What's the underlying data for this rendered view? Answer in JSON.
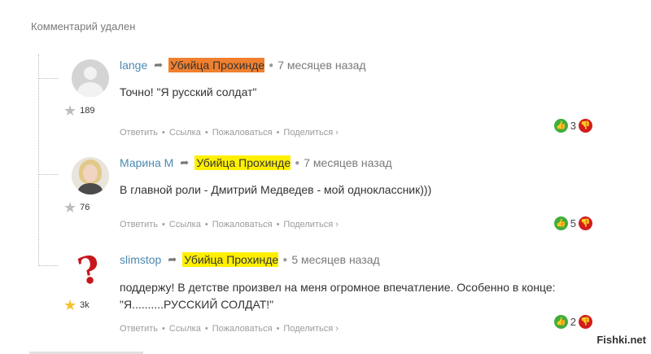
{
  "deleted_notice": "Комментарий удален",
  "comments": [
    {
      "avatar": "default-user-avatar",
      "rating": "189",
      "star": "gray",
      "author": "lange",
      "recipient": "Убийца Прохиндеев",
      "recipient_color": "#f0802f",
      "time": "7 месяцев назад",
      "text": "Точно! \"Я русский солдат\"",
      "votes": "3"
    },
    {
      "avatar": "woman-photo-avatar",
      "rating": "76",
      "star": "gray",
      "author": "Марина М",
      "recipient": "Убийца Прохиндеев",
      "recipient_color": "#fff000",
      "time": "7 месяцев назад",
      "text": "В главной роли - Дмитрий Медведев - мой одноклассник)))",
      "votes": "5"
    },
    {
      "avatar": "question-mark-avatar",
      "rating": "3k",
      "star": "gold",
      "author": "slimstop",
      "recipient": "Убийца Прохиндеев",
      "recipient_color": "#fff000",
      "time": "5 месяцев назад",
      "text_line1": "поддержу! В детстве произвел на меня огромное впечатление. Особенно в конце:",
      "text_line2": "\"Я..........РУССКИЙ СОЛДАТ!\"",
      "votes": "2"
    }
  ],
  "actions": {
    "reply": "Ответить",
    "link": "Ссылка",
    "report": "Пожаловаться",
    "share": "Поделиться ›"
  },
  "watermark": "Fishki.net",
  "colors": {
    "author": "#4c89b0",
    "vote_up": "#3fae3a",
    "vote_down": "#d21c1c",
    "star_gold": "#f2c12e"
  }
}
